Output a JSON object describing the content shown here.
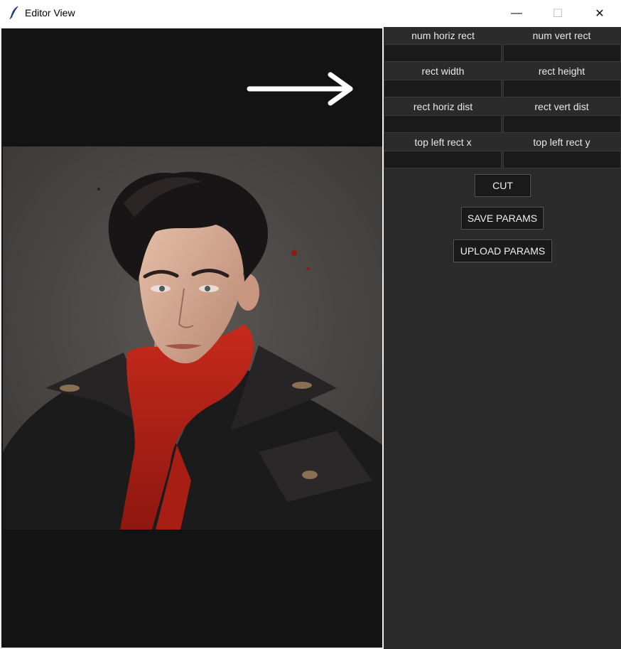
{
  "window": {
    "title": "Editor View",
    "minimize_symbol": "—",
    "maximize_symbol": "☐",
    "close_symbol": "✕"
  },
  "params": {
    "num_horiz_rect": {
      "label": "num horiz rect",
      "value": ""
    },
    "num_vert_rect": {
      "label": "num vert rect",
      "value": ""
    },
    "rect_width": {
      "label": "rect width",
      "value": ""
    },
    "rect_height": {
      "label": "rect height",
      "value": ""
    },
    "rect_horiz_dist": {
      "label": "rect horiz dist",
      "value": ""
    },
    "rect_vert_dist": {
      "label": "rect vert dist",
      "value": ""
    },
    "top_left_rect_x": {
      "label": "top left rect x",
      "value": ""
    },
    "top_left_rect_y": {
      "label": "top left rect y",
      "value": ""
    }
  },
  "buttons": {
    "cut": "CUT",
    "save_params": "SAVE PARAMS",
    "upload_params": "UPLOAD PARAMS"
  },
  "icons": {
    "app": "feather-icon",
    "navigation": "arrow-right-icon"
  },
  "colors": {
    "panel_bg": "#2b2b2b",
    "canvas_bg": "#131313",
    "input_bg": "#1a1a1a",
    "scarf_red": "#b42318"
  }
}
